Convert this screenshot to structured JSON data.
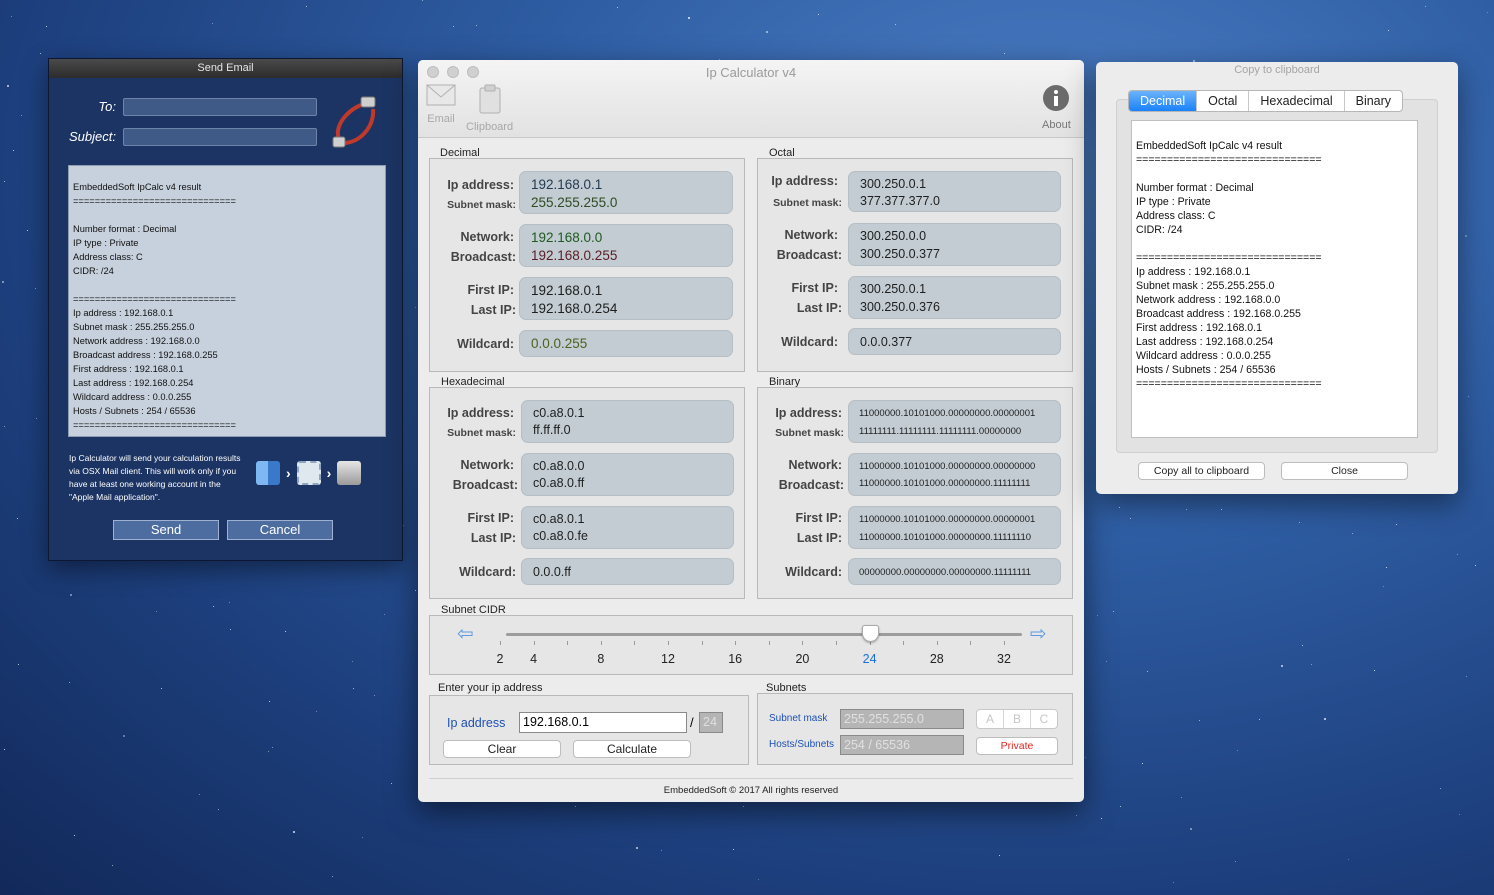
{
  "email": {
    "title": "Send Email",
    "to_label": "To:",
    "subject_label": "Subject:",
    "to_value": "",
    "subject_value": "",
    "body": "EmbeddedSoft IpCalc v4 result\n==============================\n\nNumber format : Decimal\nIP type : Private\nAddress class: C\nCIDR: /24\n\n==============================\nIp address : 192.168.0.1\nSubnet mask : 255.255.255.0\nNetwork address : 192.168.0.0\nBroadcast address : 192.168.0.255\nFirst address : 192.168.0.1\nLast address : 192.168.0.254\nWildcard address : 0.0.0.255\nHosts / Subnets : 254 / 65536\n==============================",
    "note": "Ip Calculator will send your calculation results via OSX Mail client. This will work only if you have at least one working account in the \"Apple Mail application\".",
    "send_label": "Send",
    "cancel_label": "Cancel"
  },
  "calc": {
    "title": "Ip Calculator v4",
    "toolbar": {
      "email": "Email",
      "clipboard": "Clipboard",
      "about": "About"
    },
    "labels": {
      "ip": "Ip address:",
      "mask": "Subnet mask:",
      "network": "Network:",
      "broadcast": "Broadcast:",
      "first": "First IP:",
      "last": "Last IP:",
      "wildcard": "Wildcard:"
    },
    "decimal": {
      "title": "Decimal",
      "ip": "192.168.0.1",
      "mask": "255.255.255.0",
      "network": "192.168.0.0",
      "broadcast": "192.168.0.255",
      "first": "192.168.0.1",
      "last": "192.168.0.254",
      "wildcard": "0.0.0.255"
    },
    "octal": {
      "title": "Octal",
      "ip": "300.250.0.1",
      "mask": "377.377.377.0",
      "network": "300.250.0.0",
      "broadcast": "300.250.0.377",
      "first": "300.250.0.1",
      "last": "300.250.0.376",
      "wildcard": "0.0.0.377"
    },
    "hex": {
      "title": "Hexadecimal",
      "ip": "c0.a8.0.1",
      "mask": "ff.ff.ff.0",
      "network": "c0.a8.0.0",
      "broadcast": "c0.a8.0.ff",
      "first": "c0.a8.0.1",
      "last": "c0.a8.0.fe",
      "wildcard": "0.0.0.ff"
    },
    "binary": {
      "title": "Binary",
      "ip": "11000000.10101000.00000000.00000001",
      "mask": "11111111.11111111.11111111.00000000",
      "network": "11000000.10101000.00000000.00000000",
      "broadcast": "11000000.10101000.00000000.11111111",
      "first": "11000000.10101000.00000000.00000001",
      "last": "11000000.10101000.00000000.11111110",
      "wildcard": "00000000.00000000.00000000.11111111"
    },
    "cidr": {
      "title": "Subnet CIDR",
      "value": 24,
      "min": 1,
      "max": 32,
      "ticks": [
        "2",
        "4",
        "8",
        "12",
        "16",
        "20",
        "24",
        "28",
        "32"
      ],
      "selected_color": "#1a6fe0"
    },
    "enter": {
      "title": "Enter your ip address",
      "ip_label": "Ip address",
      "ip_value": "192.168.0.1",
      "slash": "/",
      "cidr_value": "24",
      "clear_label": "Clear",
      "calculate_label": "Calculate"
    },
    "subnets": {
      "title": "Subnets",
      "mask_label": "Subnet mask",
      "mask_value": "255.255.255.0",
      "hosts_label": "Hosts/Subnets",
      "hosts_value": "254 / 65536",
      "class_a": "A",
      "class_b": "B",
      "class_c": "C",
      "type_label": "Private",
      "type_color": "#e0261f"
    },
    "footer": "EmbeddedSoft © 2017 All rights reserved"
  },
  "copy": {
    "title": "Copy to clipboard",
    "tabs": [
      "Decimal",
      "Octal",
      "Hexadecimal",
      "Binary"
    ],
    "active_tab": "Decimal",
    "body": "EmbeddedSoft IpCalc v4 result\n==============================\n\nNumber format : Decimal\nIP type : Private\nAddress class: C\nCIDR: /24\n\n==============================\nIp address : 192.168.0.1\nSubnet mask : 255.255.255.0\nNetwork address : 192.168.0.0\nBroadcast address : 192.168.0.255\nFirst address : 192.168.0.1\nLast address : 192.168.0.254\nWildcard address : 0.0.0.255\nHosts / Subnets : 254 / 65536\n==============================",
    "copy_all_label": "Copy all to clipboard",
    "close_label": "Close"
  }
}
